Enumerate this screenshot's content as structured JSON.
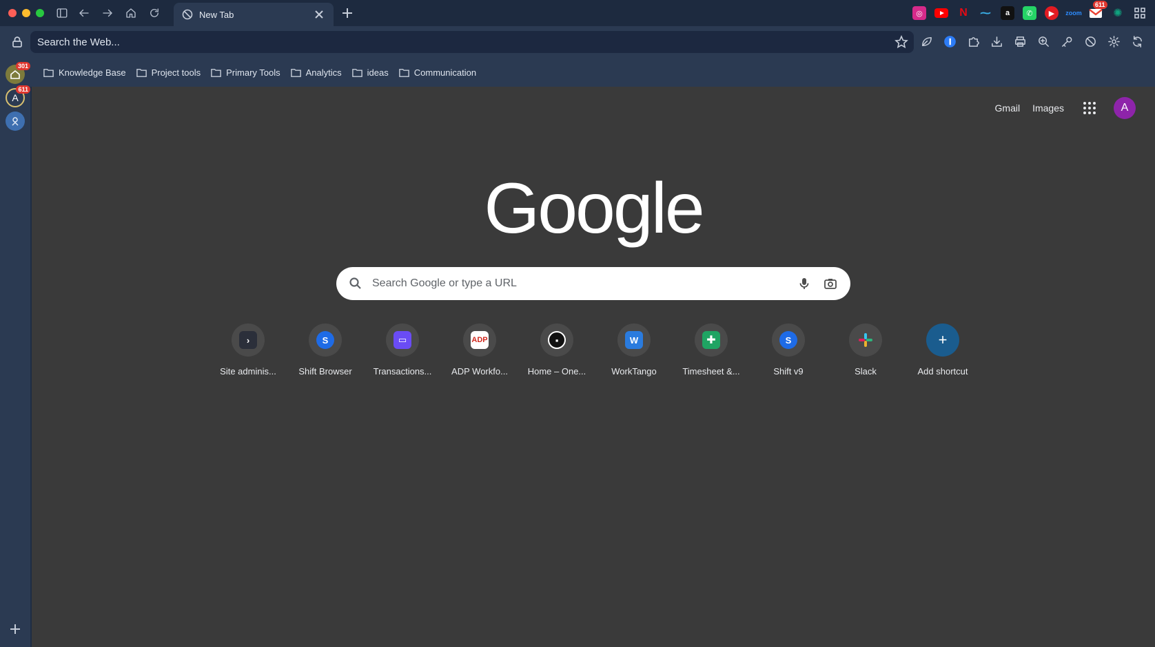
{
  "tab": {
    "title": "New Tab"
  },
  "address_bar": {
    "placeholder": "Search the Web..."
  },
  "bookmarks": [
    {
      "label": "Knowledge Base"
    },
    {
      "label": "Project tools"
    },
    {
      "label": "Primary Tools"
    },
    {
      "label": "Analytics"
    },
    {
      "label": "ideas"
    },
    {
      "label": "Communication"
    }
  ],
  "sidebar": {
    "items": [
      {
        "icon": "home-icon",
        "badge": "301"
      },
      {
        "icon": "account-a-icon",
        "letter": "A",
        "badge": "611"
      },
      {
        "icon": "workspace-icon"
      }
    ]
  },
  "extensions": {
    "mail_badge": "611"
  },
  "google": {
    "links": {
      "gmail": "Gmail",
      "images": "Images"
    },
    "avatar_letter": "A",
    "logo": "Google",
    "search_placeholder": "Search Google or type a URL"
  },
  "shortcuts": [
    {
      "label": "Site adminis...",
      "icon": "site-admin-icon",
      "color": "#2b2f3a"
    },
    {
      "label": "Shift Browser",
      "icon": "shift-icon",
      "color": "#1e6be6"
    },
    {
      "label": "Transactions...",
      "icon": "transactions-icon",
      "color": "#6a4cf5"
    },
    {
      "label": "ADP Workfo...",
      "icon": "adp-icon",
      "color": "#d0271d"
    },
    {
      "label": "Home – One...",
      "icon": "onepassword-icon",
      "color": "#111111"
    },
    {
      "label": "WorkTango",
      "icon": "worktango-icon",
      "color": "#2a7bde"
    },
    {
      "label": "Timesheet &...",
      "icon": "sheets-icon",
      "color": "#1fa463"
    },
    {
      "label": "Shift v9",
      "icon": "shift-icon",
      "color": "#1e6be6"
    },
    {
      "label": "Slack",
      "icon": "slack-icon",
      "color": "#4a154b"
    },
    {
      "label": "Add shortcut",
      "icon": "plus-icon",
      "color": "#1a5c8e"
    }
  ]
}
